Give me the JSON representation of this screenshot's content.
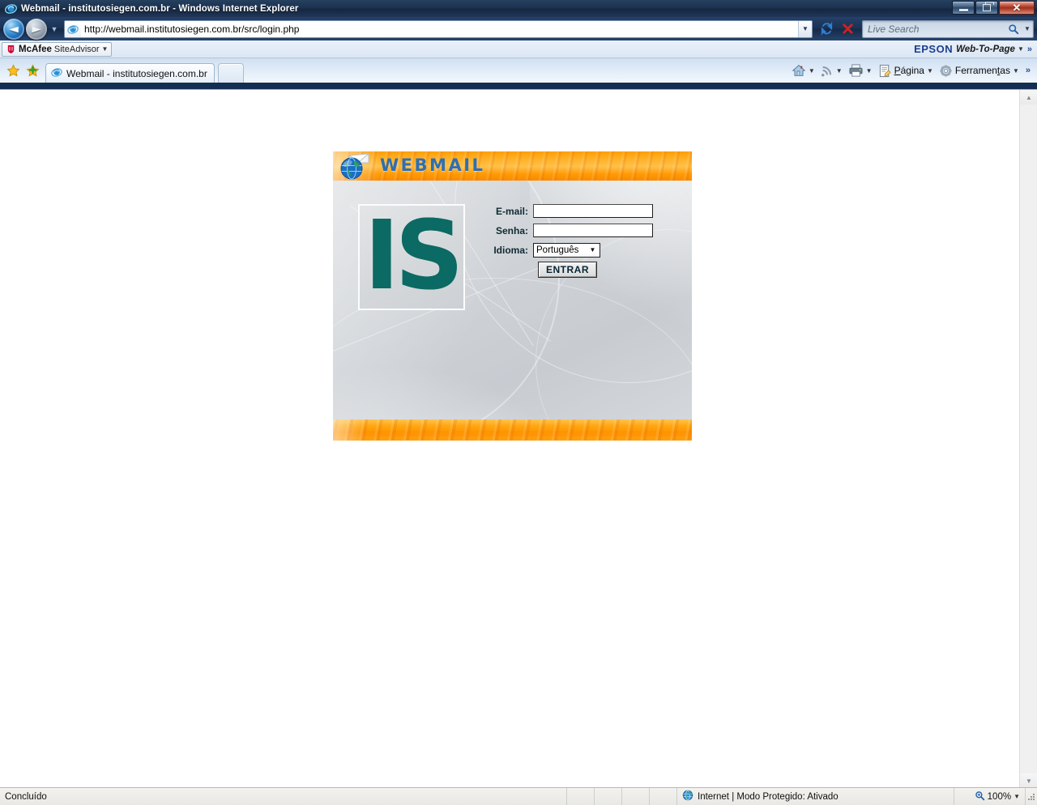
{
  "window": {
    "title": "Webmail - institutosiegen.com.br - Windows Internet Explorer",
    "minimize_label": "Minimizar",
    "restore_label": "Restaurar",
    "close_label": "Fechar"
  },
  "navigation": {
    "back_label": "Voltar",
    "forward_label": "Avançar",
    "recent_pages_label": "Páginas recentes",
    "address_value": "http://webmail.institutosiegen.com.br/src/login.php",
    "address_dropdown_label": "Histórico de endereços",
    "refresh_label": "Atualizar",
    "stop_label": "Parar",
    "search_placeholder": "Live Search",
    "search_value": "",
    "search_provider_label": "Alterar provedor de pesquisa"
  },
  "extensions_bar": {
    "mcafee_brand": "McAfee",
    "mcafee_product": "SiteAdvisor",
    "epson_brand": "EPSON",
    "epson_product": "Web-To-Page",
    "overflow_label": "»"
  },
  "tabs": {
    "favorites_label": "Favoritos",
    "add_favorite_label": "Adicionar a Favoritos",
    "items": [
      {
        "label": "Webmail - institutosiegen.com.br",
        "active": true
      },
      {
        "label": "",
        "active": false
      }
    ]
  },
  "command_bar": {
    "home_label": "Home",
    "feeds_label": "Feeds",
    "print_label": "Imprimir",
    "page_label": "Página",
    "tools_label": "Ferramentas",
    "overflow_label": "»"
  },
  "webmail": {
    "brand_wordmark": "WEBMAIL",
    "brand_letters": [
      "W",
      "E",
      "B",
      "M",
      "A",
      "I",
      "L"
    ],
    "logo_text": "IS",
    "form": {
      "email_label": "E-mail:",
      "email_value": "",
      "password_label": "Senha:",
      "password_value": "",
      "language_label": "Idioma:",
      "language_value": "Português",
      "language_options": [
        "Português"
      ],
      "submit_label": "ENTRAR"
    }
  },
  "status_bar": {
    "status_text": "Concluído",
    "zone_text": "Internet | Modo Protegido: Ativado",
    "zoom_level": "100%",
    "zoom_dropdown_label": "Alterar nível de zoom"
  },
  "colors": {
    "accent_orange": "#ff9e08",
    "brand_teal": "#0b6a63",
    "wordmark_blue": "#2f6fb0",
    "chrome_blue": "#1a3254"
  }
}
